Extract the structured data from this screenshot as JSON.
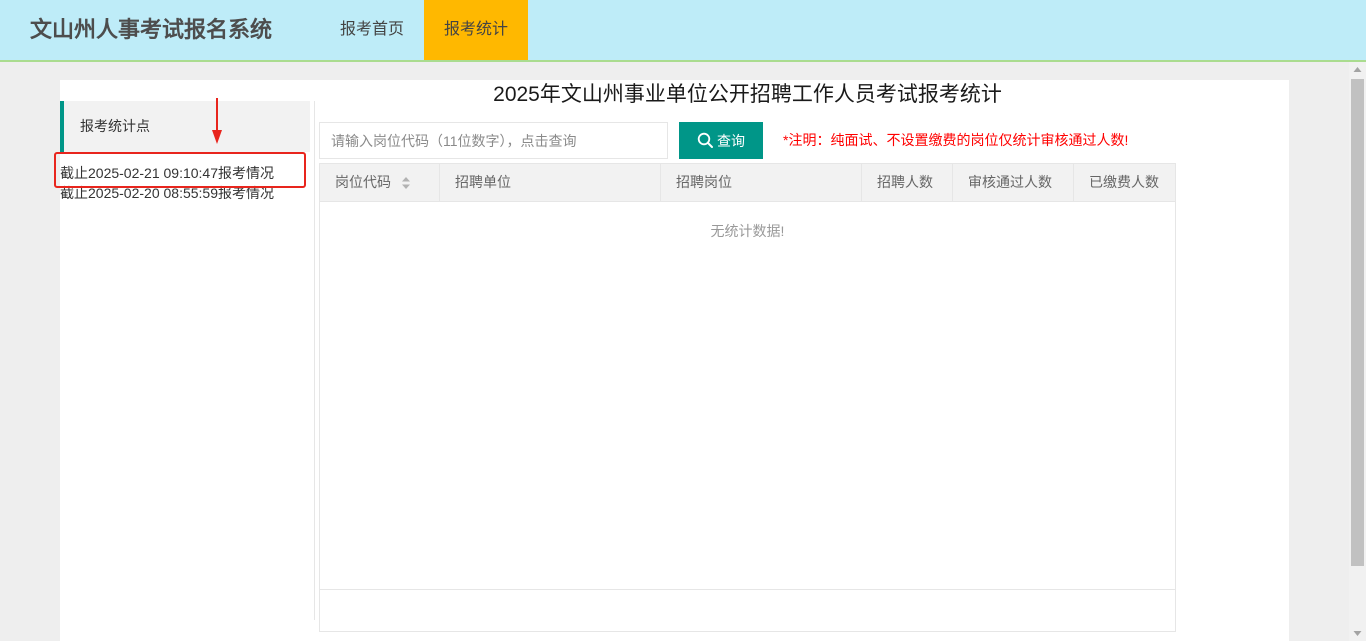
{
  "app": {
    "title": "文山州人事考试报名系统"
  },
  "nav": {
    "items": [
      {
        "label": "报考首页",
        "active": false
      },
      {
        "label": "报考统计",
        "active": true
      }
    ]
  },
  "sidebar": {
    "header": "报考统计点",
    "items": [
      {
        "label": "截止2025-02-21 09:10:47报考情况",
        "highlighted": true
      },
      {
        "label": "截止2025-02-20 08:55:59报考情况",
        "highlighted": false
      }
    ]
  },
  "main": {
    "title": "2025年文山州事业单位公开招聘工作人员考试报考统计",
    "search": {
      "placeholder": "请输入岗位代码（11位数字），点击查询",
      "value": "",
      "button_label": "查询",
      "button_icon": "search-icon"
    },
    "note": "*注明：纯面试、不设置缴费的岗位仅统计审核通过人数!"
  },
  "table": {
    "columns": [
      {
        "label": "岗位代码",
        "sortable": true,
        "icon": "sort-icon"
      },
      {
        "label": "招聘单位",
        "sortable": false
      },
      {
        "label": "招聘岗位",
        "sortable": false
      },
      {
        "label": "招聘人数",
        "sortable": false
      },
      {
        "label": "审核通过人数",
        "sortable": false
      },
      {
        "label": "已缴费人数",
        "sortable": false
      }
    ],
    "rows": [],
    "empty_text": "无统计数据!"
  },
  "colors": {
    "header-bg": "#beecf8",
    "header-border": "#aadc8f",
    "active-nav": "#ffb800",
    "accent": "#009688",
    "note": "#ff0000",
    "annotation": "#e8251d",
    "page-bg": "#eeeeee"
  }
}
